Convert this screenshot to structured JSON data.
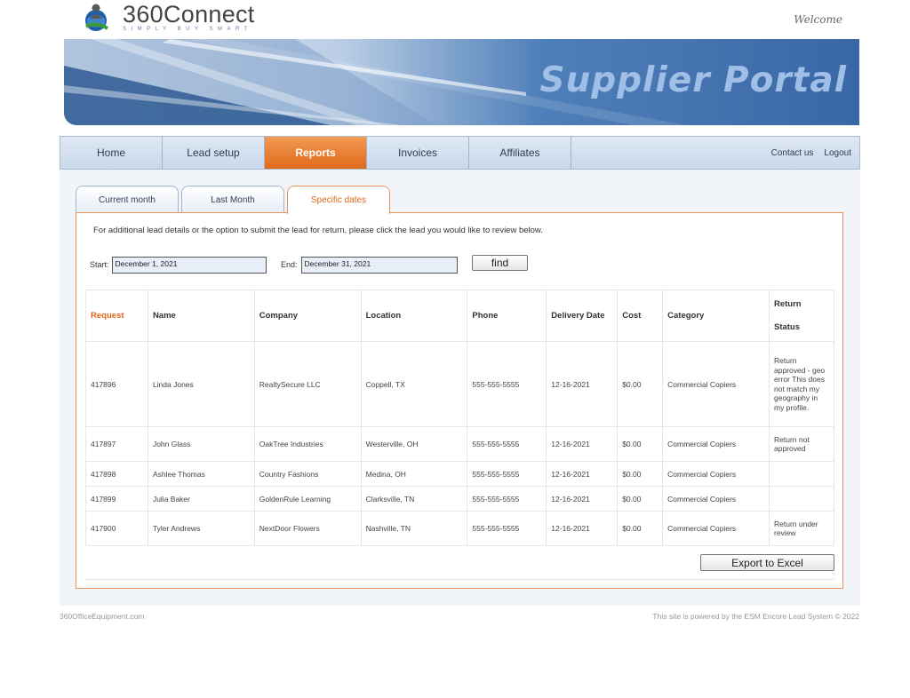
{
  "header": {
    "logo_name": "360Connect",
    "logo_tagline": "SIMPLY BUY SMART",
    "welcome": "Welcome",
    "banner_title": "Supplier Portal"
  },
  "nav": {
    "items": [
      {
        "label": "Home"
      },
      {
        "label": "Lead setup"
      },
      {
        "label": "Reports",
        "active": true
      },
      {
        "label": "Invoices"
      },
      {
        "label": "Affiliates"
      }
    ],
    "contact": "Contact us",
    "logout": "Logout"
  },
  "tabs": [
    {
      "label": "Current month"
    },
    {
      "label": "Last Month"
    },
    {
      "label": "Specific dates",
      "active": true
    }
  ],
  "report": {
    "info_text": "For additional lead details or the option to submit the lead for return, please click the lead you would like to review below.",
    "start_label": "Start:",
    "start_value": "December 1, 2021",
    "end_label": "End:",
    "end_value": "December 31, 2021",
    "find_label": "find",
    "export_label": "Export to Excel"
  },
  "table": {
    "headers": {
      "request": "Request",
      "name": "Name",
      "company": "Company",
      "location": "Location",
      "phone": "Phone",
      "delivery": "Delivery Date",
      "cost": "Cost",
      "category": "Category",
      "status_line1": "Return",
      "status_line2": "Status"
    },
    "rows": [
      {
        "request": "417896",
        "name": "Linda Jones",
        "company": "RealtySecure LLC",
        "location": "Coppell, TX",
        "phone": "555-555-5555",
        "delivery": "12-16-2021",
        "cost": "$0.00",
        "category": "Commercial Copiers",
        "status": "Return approved - geo error This does not match my geography in my profile."
      },
      {
        "request": "417897",
        "name": "John Glass",
        "company": "OakTree Industries",
        "location": "Westerville, OH",
        "phone": "555-555-5555",
        "delivery": "12-16-2021",
        "cost": "$0.00",
        "category": "Commercial Copiers",
        "status": "Return not approved"
      },
      {
        "request": "417898",
        "name": "Ashlee Thomas",
        "company": "Country Fashions",
        "location": "Medina, OH",
        "phone": "555-555-5555",
        "delivery": "12-16-2021",
        "cost": "$0.00",
        "category": "Commercial Copiers",
        "status": ""
      },
      {
        "request": "417899",
        "name": "Julia Baker",
        "company": "GoldenRule Learning",
        "location": "Clarksville, TN",
        "phone": "555-555-5555",
        "delivery": "12-16-2021",
        "cost": "$0.00",
        "category": "Commercial Copiers",
        "status": ""
      },
      {
        "request": "417900",
        "name": "Tyler Andrews",
        "company": "NextDoor Flowers",
        "location": "Nashville, TN",
        "phone": "555-555-5555",
        "delivery": "12-16-2021",
        "cost": "$0.00",
        "category": "Commercial Copiers",
        "status": "Return under review"
      }
    ]
  },
  "footer": {
    "left": "360OfficeEquipment.com",
    "right": "This site is powered by the ESM Encore Lead System © 2022"
  },
  "colors": {
    "accent_orange": "#e0661b",
    "banner_blue": "#3f6fae",
    "nav_bg": "#d3dfed"
  }
}
